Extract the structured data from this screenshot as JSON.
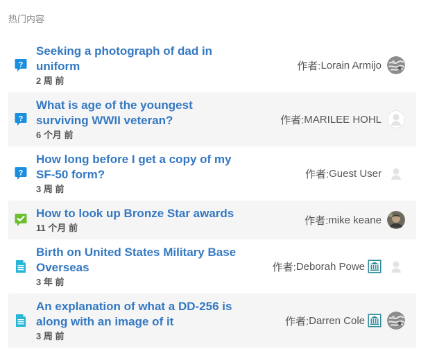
{
  "header": {
    "title": "热门内容"
  },
  "author_prefix": "作者:",
  "items": [
    {
      "title_line1": "Seeking a photograph of dad in",
      "title_line2": "uniform",
      "meta": "2 周 前",
      "author": "Lorain Armijo",
      "type_icon": "question-icon",
      "avatar": "patterned-avatar",
      "badge": ""
    },
    {
      "title_line1": "What is age of the youngest",
      "title_line2": "surviving WWII veteran?",
      "meta": "6 个月 前",
      "author": "MARILEE HOHL",
      "type_icon": "question-icon",
      "avatar": "default-avatar",
      "badge": ""
    },
    {
      "title_line1": "How long before I get a copy of my",
      "title_line2": "SF-50 form?",
      "meta": "3 周 前",
      "author": "Guest User",
      "type_icon": "question-icon",
      "avatar": "default-avatar",
      "badge": ""
    },
    {
      "title_line1": "How to look up Bronze Star awards",
      "title_line2": "",
      "meta": "11 个月 前",
      "author": "mike keane",
      "type_icon": "answered-icon",
      "avatar": "photo-avatar",
      "badge": ""
    },
    {
      "title_line1": "Birth on United States Military Base",
      "title_line2": "Overseas",
      "meta": "3 年 前",
      "author": "Deborah Powe",
      "type_icon": "document-icon",
      "avatar": "default-avatar",
      "badge": "archives-badge-icon"
    },
    {
      "title_line1": "An explanation of what a DD-256 is",
      "title_line2": "along with an image of it",
      "meta": "3 周 前",
      "author": "Darren Cole",
      "type_icon": "document-icon",
      "avatar": "patterned-avatar",
      "badge": "archives-badge-icon"
    }
  ],
  "colors": {
    "link": "#3478c2",
    "question": "#1a8fe0",
    "answered": "#6cbf2e",
    "document": "#27b6d6",
    "alt_row": "#f5f5f5"
  }
}
